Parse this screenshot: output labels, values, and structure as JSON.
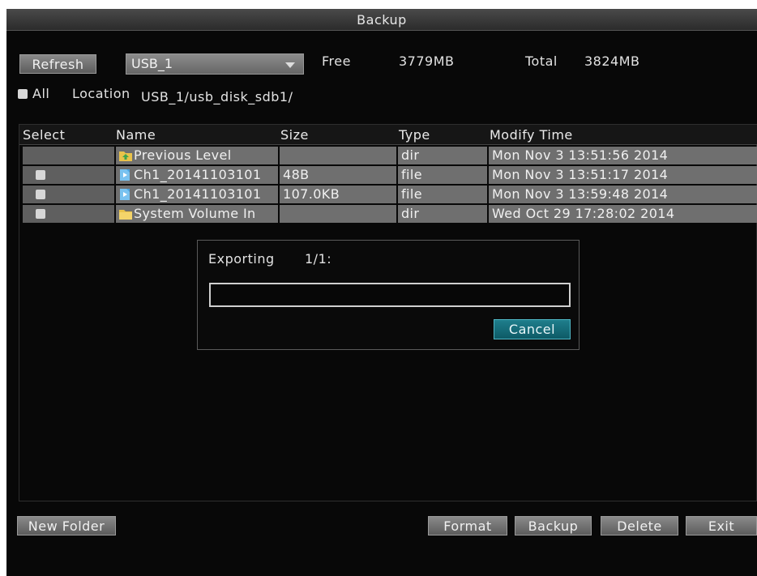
{
  "window": {
    "title": "Backup"
  },
  "toolbar": {
    "refresh_label": "Refresh",
    "device_selected": "USB_1",
    "free_label": "Free",
    "free_value": "3779MB",
    "total_label": "Total",
    "total_value": "3824MB",
    "all_label": "All",
    "location_label": "Location",
    "location_value": "USB_1/usb_disk_sdb1/"
  },
  "table": {
    "headers": [
      "Select",
      "Name",
      "Size",
      "Type",
      "Modify Time"
    ],
    "rows": [
      {
        "name": "Previous Level",
        "size": "",
        "type": "dir",
        "modified": "Mon Nov  3 13:51:56 2014",
        "icon": "folder-up-icon",
        "has_checkbox": false
      },
      {
        "name": "Ch1_20141103101",
        "size": "48B",
        "type": "file",
        "modified": "Mon Nov  3 13:51:17 2014",
        "icon": "video-file-icon",
        "has_checkbox": true
      },
      {
        "name": "Ch1_20141103101",
        "size": "107.0KB",
        "type": "file",
        "modified": "Mon Nov  3 13:59:48 2014",
        "icon": "video-file-icon",
        "has_checkbox": true
      },
      {
        "name": "System Volume In",
        "size": "",
        "type": "dir",
        "modified": "Wed Oct 29 17:28:02 2014",
        "icon": "folder-icon",
        "has_checkbox": true
      }
    ]
  },
  "dialog": {
    "status_label": "Exporting",
    "progress_text": "1/1:",
    "progress_fraction": 0.0,
    "cancel_label": "Cancel"
  },
  "footer": {
    "new_folder_label": "New Folder",
    "format_label": "Format",
    "backup_label": "Backup",
    "delete_label": "Delete",
    "exit_label": "Exit"
  },
  "colors": {
    "accent": "#1f7e8c",
    "row_bg": "#6f6f6f",
    "background": "#080808"
  }
}
